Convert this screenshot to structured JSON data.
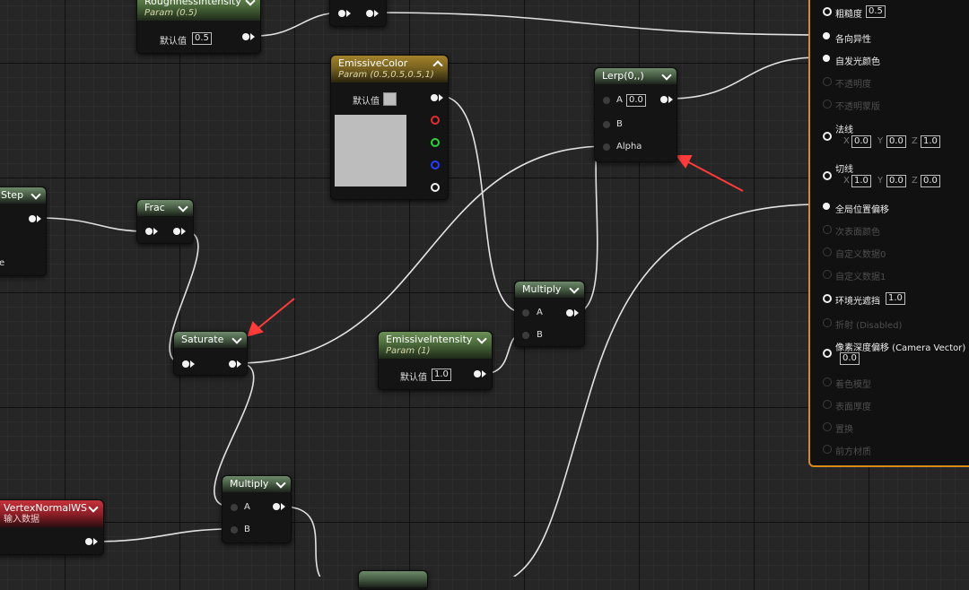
{
  "nodes": {
    "roughness": {
      "title": "RoughnessIntensity",
      "sub": "Param (0.5)",
      "default_label": "默认值",
      "value": "0.5"
    },
    "emissive_color": {
      "title": "EmissiveColor",
      "sub": "Param (0.5,0.5,0.5,1)",
      "default_label": "默认值",
      "color": "#bdbdbd"
    },
    "lerp": {
      "title": "Lerp(0,,)",
      "pin_a": "A",
      "a_value": "0.0",
      "pin_b": "B",
      "pin_alpha": "Alpha"
    },
    "step": {
      "title": "Step",
      "tail": "e"
    },
    "frac": {
      "title": "Frac"
    },
    "saturate": {
      "title": "Saturate"
    },
    "multiply1": {
      "title": "Multiply",
      "pin_a": "A",
      "pin_b": "B"
    },
    "emissive_intensity": {
      "title": "EmissiveIntensity",
      "sub": "Param (1)",
      "default_label": "默认值",
      "value": "1.0"
    },
    "multiply2": {
      "title": "Multiply",
      "pin_a": "A",
      "pin_b": "B"
    },
    "vertex_normal": {
      "title": "VertexNormalWS",
      "sub": "输入数据"
    }
  },
  "panel": {
    "roughness": {
      "label": "粗糙度",
      "value": "0.5"
    },
    "anisotropy": "各向异性",
    "emissive": "自发光颜色",
    "opacity": "不透明度",
    "opacity_mask": "不透明蒙版",
    "normal": {
      "label": "法线",
      "x": "0.0",
      "y": "0.0",
      "z": "1.0"
    },
    "tangent": {
      "label": "切线",
      "x": "1.0",
      "y": "0.0",
      "z": "0.0"
    },
    "wpo": "全局位置偏移",
    "subsurface": "次表面颜色",
    "custom0": "自定义数据0",
    "custom1": "自定义数据1",
    "ao": {
      "label": "环境光遮挡",
      "value": "1.0"
    },
    "refraction": "折射 (Disabled)",
    "pdo": {
      "label": "像素深度偏移 (Camera Vector)",
      "value": "0.0"
    },
    "shading_model": "着色模型",
    "surface_thickness": "表面厚度",
    "displacement": "置换",
    "front_material": "前方材质",
    "axis": {
      "x": "X",
      "y": "Y",
      "z": "Z"
    }
  }
}
